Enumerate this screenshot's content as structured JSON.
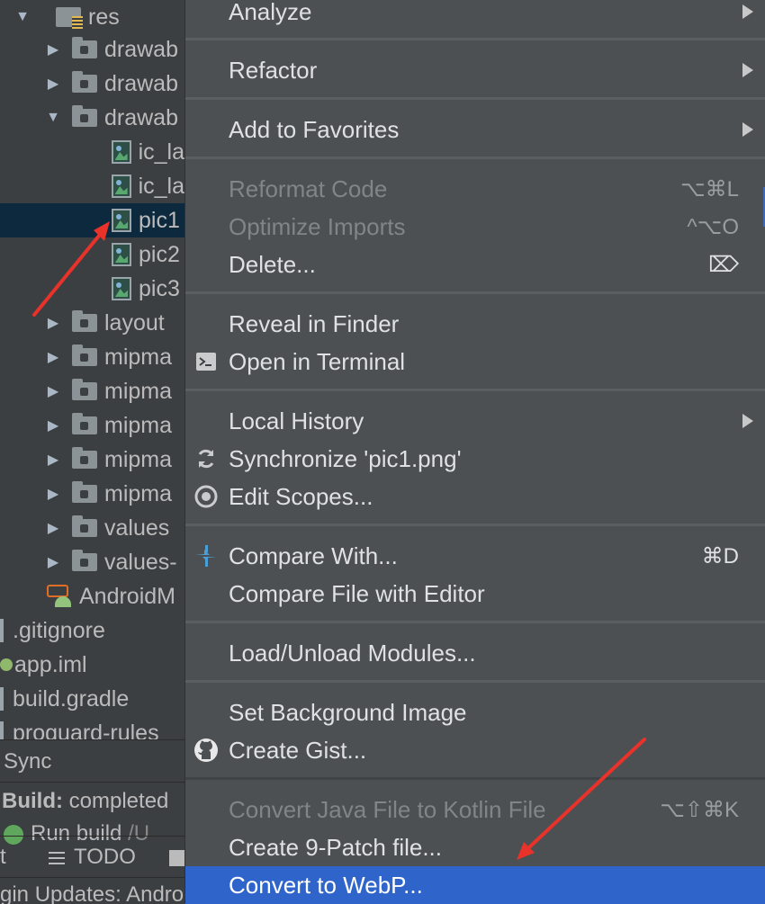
{
  "tree": {
    "rows": [
      {
        "label": "res"
      },
      {
        "label": "drawab"
      },
      {
        "label": "drawab"
      },
      {
        "label": "drawab"
      },
      {
        "label": "ic_la"
      },
      {
        "label": "ic_la"
      },
      {
        "label": "pic1"
      },
      {
        "label": "pic2"
      },
      {
        "label": "pic3"
      },
      {
        "label": "layout"
      },
      {
        "label": "mipma"
      },
      {
        "label": "mipma"
      },
      {
        "label": "mipma"
      },
      {
        "label": "mipma"
      },
      {
        "label": "mipma"
      },
      {
        "label": "values"
      },
      {
        "label": "values-"
      },
      {
        "label": "AndroidM"
      },
      {
        "label": ".gitignore"
      },
      {
        "label": "app.iml"
      },
      {
        "label": "build.gradle"
      },
      {
        "label": "proguard-rules"
      }
    ]
  },
  "bottom": {
    "sync_tab": "Sync",
    "build_bold": "Build:",
    "build_status": " completed",
    "run_build": "Run build",
    "run_path": " /U",
    "tab_left": "t",
    "todo_tab": "TODO",
    "plugin_updates": "gin Updates: Androi"
  },
  "menu": {
    "analyze": "Analyze",
    "refactor": "Refactor",
    "add_favorites": "Add to Favorites",
    "reformat": "Reformat Code",
    "reformat_sc": "⌥⌘L",
    "optimize": "Optimize Imports",
    "optimize_sc": "^⌥O",
    "delete": "Delete...",
    "delete_sc": "⌦",
    "reveal": "Reveal in Finder",
    "terminal": "Open in Terminal",
    "local_history": "Local History",
    "synchronize": "Synchronize 'pic1.png'",
    "edit_scopes": "Edit Scopes...",
    "compare_with": "Compare With...",
    "compare_with_sc": "⌘D",
    "compare_editor": "Compare File with Editor",
    "load_modules": "Load/Unload Modules...",
    "set_bg": "Set Background Image",
    "create_gist": "Create Gist...",
    "convert_kotlin": "Convert Java File to Kotlin File",
    "convert_kotlin_sc": "⌥⇧⌘K",
    "nine_patch": "Create 9-Patch file...",
    "webp": "Convert to WebP..."
  },
  "colors": {
    "menu_bg": "#4c5052",
    "selection": "#2f65ca",
    "tree_selected": "#0d293e",
    "annotation": "#e8322a"
  }
}
